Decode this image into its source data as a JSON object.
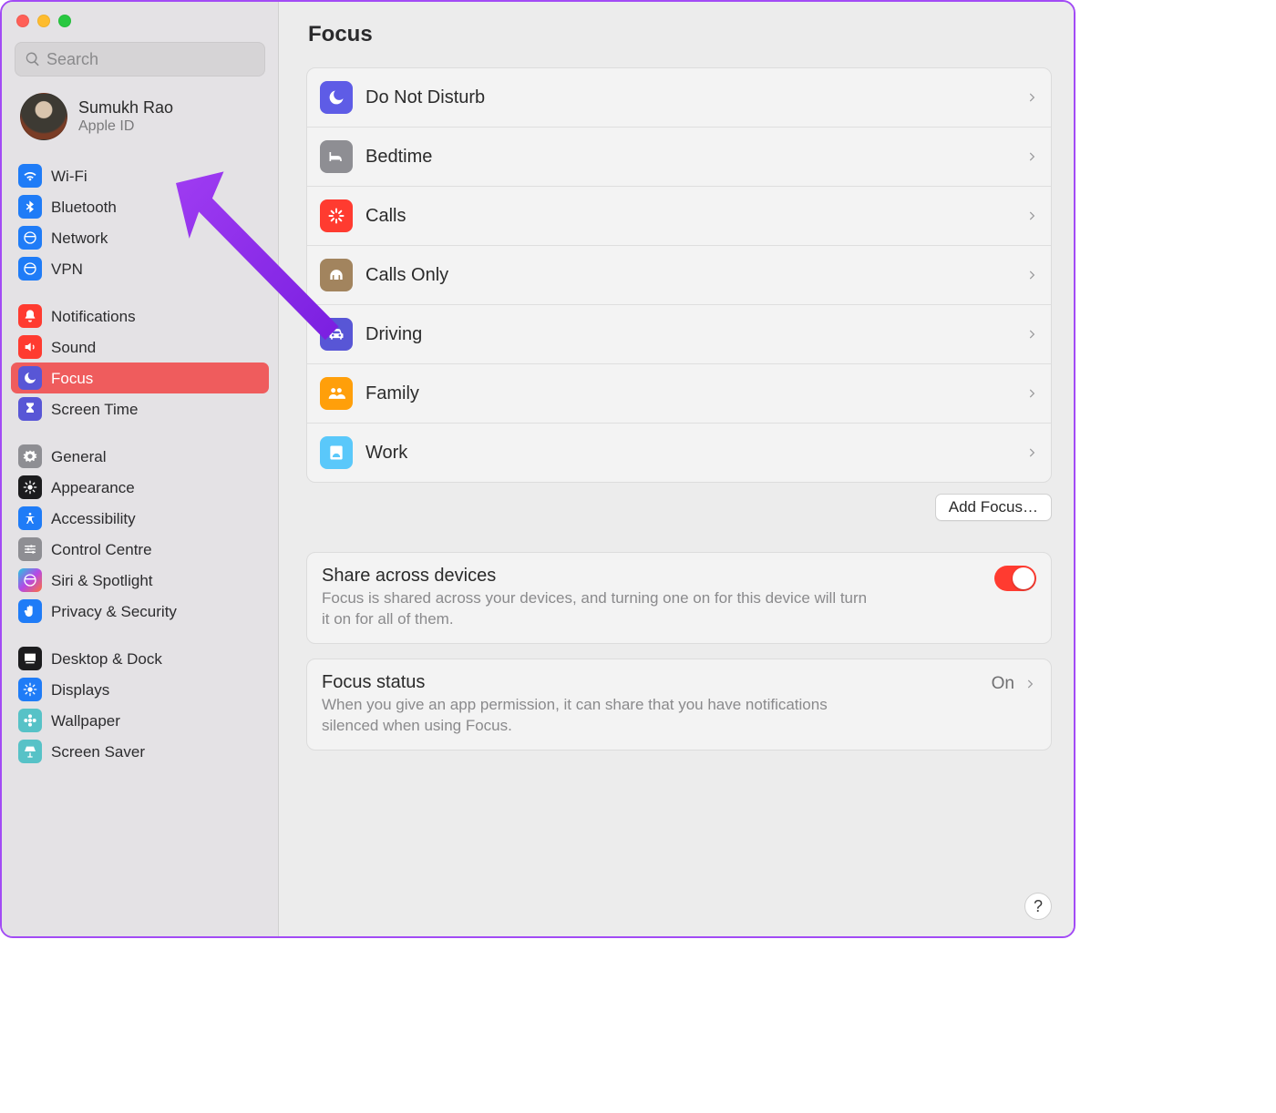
{
  "search": {
    "placeholder": "Search"
  },
  "account": {
    "name": "Sumukh Rao",
    "subtitle": "Apple ID"
  },
  "sidebar_groups": [
    {
      "items": [
        {
          "key": "wifi",
          "label": "Wi-Fi"
        },
        {
          "key": "bluetooth",
          "label": "Bluetooth"
        },
        {
          "key": "network",
          "label": "Network"
        },
        {
          "key": "vpn",
          "label": "VPN"
        }
      ]
    },
    {
      "items": [
        {
          "key": "notifications",
          "label": "Notifications"
        },
        {
          "key": "sound",
          "label": "Sound"
        },
        {
          "key": "focus",
          "label": "Focus",
          "selected": true
        },
        {
          "key": "screentime",
          "label": "Screen Time"
        }
      ]
    },
    {
      "items": [
        {
          "key": "general",
          "label": "General"
        },
        {
          "key": "appearance",
          "label": "Appearance"
        },
        {
          "key": "accessibility",
          "label": "Accessibility"
        },
        {
          "key": "controlcentre",
          "label": "Control Centre"
        },
        {
          "key": "siri",
          "label": "Siri & Spotlight"
        },
        {
          "key": "privacy",
          "label": "Privacy & Security"
        }
      ]
    },
    {
      "items": [
        {
          "key": "desktopdock",
          "label": "Desktop & Dock"
        },
        {
          "key": "displays",
          "label": "Displays"
        },
        {
          "key": "wallpaper",
          "label": "Wallpaper"
        },
        {
          "key": "screensaver",
          "label": "Screen Saver"
        }
      ]
    }
  ],
  "page": {
    "title": "Focus"
  },
  "focus_modes": [
    {
      "key": "dnd",
      "label": "Do Not Disturb"
    },
    {
      "key": "bedtime",
      "label": "Bedtime"
    },
    {
      "key": "calls",
      "label": "Calls"
    },
    {
      "key": "callsonly",
      "label": "Calls Only"
    },
    {
      "key": "driving",
      "label": "Driving"
    },
    {
      "key": "family",
      "label": "Family"
    },
    {
      "key": "work",
      "label": "Work"
    }
  ],
  "add_focus_label": "Add Focus…",
  "share_section": {
    "title": "Share across devices",
    "description": "Focus is shared across your devices, and turning one on for this device will turn it on for all of them.",
    "enabled": true
  },
  "status_section": {
    "title": "Focus status",
    "value": "On",
    "description": "When you give an app permission, it can share that you have notifications silenced when using Focus."
  },
  "help_label": "?"
}
